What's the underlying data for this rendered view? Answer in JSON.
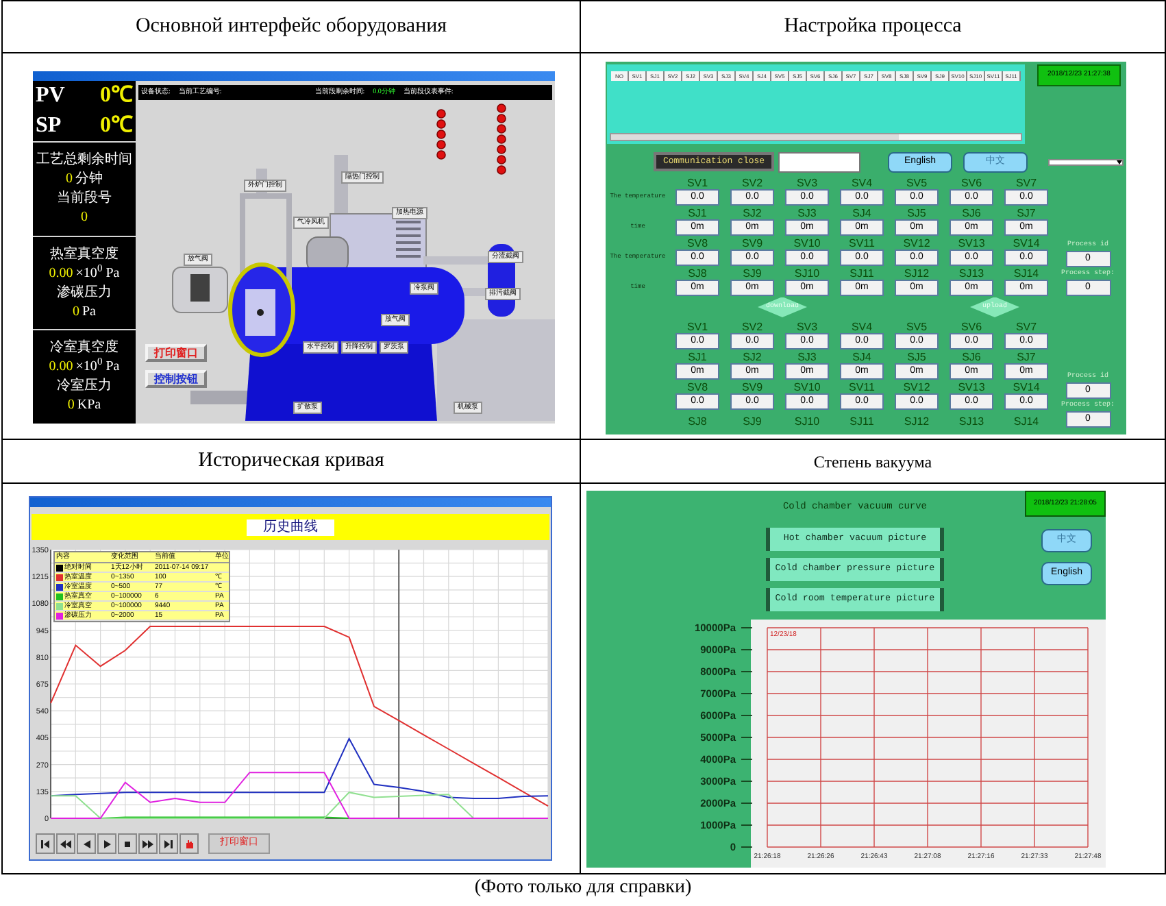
{
  "figures": [
    {
      "kind": "equipment",
      "heading": "Основной интерфейс оборудования",
      "screen": {
        "readout_boxes": [
          {
            "kind": "large",
            "lines": [
              [
                {
                  "kind": "label",
                  "text": "PV"
                },
                {
                  "kind": "value",
                  "text": "0℃"
                }
              ],
              [
                {
                  "kind": "label",
                  "text": "SP"
                },
                {
                  "kind": "value",
                  "text": "0℃"
                }
              ]
            ]
          },
          {
            "kind": "normal",
            "lines": [
              [
                {
                  "kind": "label",
                  "text": "工艺总剩余时间"
                }
              ],
              [
                {
                  "kind": "value",
                  "text": "0"
                },
                {
                  "kind": "label",
                  "text": "分钟"
                }
              ],
              [
                {
                  "kind": "label",
                  "text": "当前段号"
                }
              ],
              [
                {
                  "kind": "value",
                  "text": "0"
                }
              ]
            ]
          },
          {
            "kind": "normal",
            "lines": [
              [
                {
                  "kind": "label",
                  "text": "热室真空度"
                }
              ],
              [
                {
                  "kind": "value",
                  "text": "0.00"
                },
                {
                  "kind": "label",
                  "text": "×10$^{0}$ Pa"
                }
              ],
              [
                {
                  "kind": "label",
                  "text": "渗碳压力"
                }
              ],
              [
                {
                  "kind": "value",
                  "text": "0"
                },
                {
                  "kind": "label",
                  "text": "Pa"
                }
              ]
            ]
          },
          {
            "kind": "normal",
            "lines": [
              [
                {
                  "kind": "label",
                  "text": "冷室真空度"
                }
              ],
              [
                {
                  "kind": "value",
                  "text": "0.00"
                },
                {
                  "kind": "label",
                  "text": "×10$^{0}$ Pa"
                }
              ],
              [
                {
                  "kind": "label",
                  "text": "冷室压力"
                }
              ],
              [
                {
                  "kind": "value",
                  "text": "0"
                },
                {
                  "kind": "label",
                  "text": "KPa"
                }
              ]
            ]
          }
        ],
        "status_bar": [
          {
            "kind": "label",
            "text": "设备状态:"
          },
          {
            "kind": "label",
            "text": "当前工艺编号:"
          },
          {
            "kind": "label",
            "text": "当前段剩余时间:"
          },
          {
            "kind": "value",
            "text": "0.0分钟"
          },
          {
            "kind": "label",
            "text": "当前段仪表事件:"
          }
        ],
        "diagram_labels": [
          "外炉门控制",
          "隔热门控制",
          "气冷风机",
          "加热电源",
          "放气阀",
          "分流截阀",
          "冷泵阀",
          "排污截阀",
          "放气阀",
          "水平控制",
          "升降控制",
          "罗茨泵",
          "扩散泵",
          "机械泵"
        ],
        "diagram_buttons": [
          {
            "label": "打印窗口",
            "color": "#e02020"
          },
          {
            "label": "控制按钮",
            "color": "#2030d0"
          }
        ]
      }
    },
    {
      "kind": "process",
      "heading": "Настройка процесса",
      "screen": {
        "record_list": {
          "columns": [
            "NO",
            "SV1",
            "SJ1",
            "SV2",
            "SJ2",
            "SV3",
            "SJ3",
            "SV4",
            "SJ4",
            "SV5",
            "SJ5",
            "SV6",
            "SJ6",
            "SV7",
            "SJ7",
            "SV8",
            "SJ8",
            "SV9",
            "SJ9",
            "SV10",
            "SJ10",
            "SV11",
            "SJ11"
          ]
        },
        "clock": "2018/12/23 21:27:38",
        "connection_button": "Communication close",
        "language_buttons": [
          "English",
          "中文"
        ],
        "groups": [
          {
            "rows": [
              {
                "label": "The temperature",
                "cells": [
                  {
                    "name": "SV1",
                    "value": "0.0"
                  },
                  {
                    "name": "SV2",
                    "value": "0.0"
                  },
                  {
                    "name": "SV3",
                    "value": "0.0"
                  },
                  {
                    "name": "SV4",
                    "value": "0.0"
                  },
                  {
                    "name": "SV5",
                    "value": "0.0"
                  },
                  {
                    "name": "SV6",
                    "value": "0.0"
                  },
                  {
                    "name": "SV7",
                    "value": "0.0"
                  }
                ]
              },
              {
                "label": "time",
                "cells": [
                  {
                    "name": "SJ1",
                    "value": "0m"
                  },
                  {
                    "name": "SJ2",
                    "value": "0m"
                  },
                  {
                    "name": "SJ3",
                    "value": "0m"
                  },
                  {
                    "name": "SJ4",
                    "value": "0m"
                  },
                  {
                    "name": "SJ5",
                    "value": "0m"
                  },
                  {
                    "name": "SJ6",
                    "value": "0m"
                  },
                  {
                    "name": "SJ7",
                    "value": "0m"
                  }
                ]
              },
              {
                "label": "The temperature",
                "cells": [
                  {
                    "name": "SV8",
                    "value": "0.0"
                  },
                  {
                    "name": "SV9",
                    "value": "0.0"
                  },
                  {
                    "name": "SV10",
                    "value": "0.0"
                  },
                  {
                    "name": "SV11",
                    "value": "0.0"
                  },
                  {
                    "name": "SV12",
                    "value": "0.0"
                  },
                  {
                    "name": "SV13",
                    "value": "0.0"
                  },
                  {
                    "name": "SV14",
                    "value": "0.0"
                  }
                ]
              },
              {
                "label": "time",
                "cells": [
                  {
                    "name": "SJ8",
                    "value": "0m"
                  },
                  {
                    "name": "SJ9",
                    "value": "0m"
                  },
                  {
                    "name": "SJ10",
                    "value": "0m"
                  },
                  {
                    "name": "SJ11",
                    "value": "0m"
                  },
                  {
                    "name": "SJ12",
                    "value": "0m"
                  },
                  {
                    "name": "SJ13",
                    "value": "0m"
                  },
                  {
                    "name": "SJ14",
                    "value": "0m"
                  }
                ]
              }
            ],
            "side": [
              {
                "label": "Process id",
                "value": "0"
              },
              {
                "label": "Process step:",
                "value": "0"
              }
            ]
          },
          {
            "rows": [
              {
                "cells": [
                  {
                    "name": "SV1",
                    "value": "0.0"
                  },
                  {
                    "name": "SV2",
                    "value": "0.0"
                  },
                  {
                    "name": "SV3",
                    "value": "0.0"
                  },
                  {
                    "name": "SV4",
                    "value": "0.0"
                  },
                  {
                    "name": "SV5",
                    "value": "0.0"
                  },
                  {
                    "name": "SV6",
                    "value": "0.0"
                  },
                  {
                    "name": "SV7",
                    "value": "0.0"
                  }
                ]
              },
              {
                "cells": [
                  {
                    "name": "SJ1",
                    "value": "0m"
                  },
                  {
                    "name": "SJ2",
                    "value": "0m"
                  },
                  {
                    "name": "SJ3",
                    "value": "0m"
                  },
                  {
                    "name": "SJ4",
                    "value": "0m"
                  },
                  {
                    "name": "SJ5",
                    "value": "0m"
                  },
                  {
                    "name": "SJ6",
                    "value": "0m"
                  },
                  {
                    "name": "SJ7",
                    "value": "0m"
                  }
                ]
              },
              {
                "cells": [
                  {
                    "name": "SV8",
                    "value": "0.0"
                  },
                  {
                    "name": "SV9",
                    "value": "0.0"
                  },
                  {
                    "name": "SV10",
                    "value": "0.0"
                  },
                  {
                    "name": "SV11",
                    "value": "0.0"
                  },
                  {
                    "name": "SV12",
                    "value": "0.0"
                  },
                  {
                    "name": "SV13",
                    "value": "0.0"
                  },
                  {
                    "name": "SV14",
                    "value": "0.0"
                  }
                ]
              },
              {
                "cells": [
                  {
                    "name": "SJ8"
                  },
                  {
                    "name": "SJ9"
                  },
                  {
                    "name": "SJ10"
                  },
                  {
                    "name": "SJ11"
                  },
                  {
                    "name": "SJ12"
                  },
                  {
                    "name": "SJ13"
                  },
                  {
                    "name": "SJ14"
                  }
                ]
              }
            ],
            "side": [
              {
                "label": "Process id",
                "value": "0"
              },
              {
                "label": "Process step:",
                "value": "0"
              }
            ]
          }
        ],
        "transfer_buttons": [
          "download",
          "upload"
        ]
      }
    },
    {
      "kind": "history",
      "heading": "Историческая кривая",
      "screen": {
        "title": "历史曲线",
        "legend": {
          "header": [
            "内容",
            "变化范围",
            "当前值",
            "单位"
          ],
          "time_row": {
            "color": "#000000",
            "cells": [
              "绝对时间",
              "1天12小时",
              "2011-07-14 09:17"
            ]
          },
          "rows": [
            {
              "cells": [
                "0~1350",
                "100",
                "℃"
              ]
            },
            {
              "cells": [
                "0~500",
                "77",
                "℃"
              ]
            },
            {
              "cells": [
                "0~100000",
                "6",
                "PA"
              ]
            },
            {
              "cells": [
                "0~100000",
                "9440",
                "PA"
              ]
            },
            {
              "cells": [
                "0~2000",
                "15",
                "PA"
              ]
            }
          ]
        },
        "chart_data": {
          "type": "line",
          "grid": true,
          "legend": "upper left",
          "ylim": [
            0,
            1350
          ],
          "yticks": [
            0,
            135,
            270,
            405,
            540,
            675,
            810,
            945,
            1080,
            1215,
            1350
          ],
          "categories": [
            null,
            null,
            null,
            null,
            null,
            null,
            null,
            null,
            null,
            null,
            null,
            null,
            null,
            null,
            null,
            null,
            null,
            null,
            null,
            null,
            null
          ],
          "series": [
            {
              "name": "热室温度",
              "color": "#e03030",
              "values": [
                578,
                869,
                764,
                844,
                964,
                964,
                964,
                964,
                964,
                964,
                964,
                964,
                910,
                562,
                491,
                419,
                348,
                276,
                205,
                133,
                61
              ]
            },
            {
              "name": "冷室温度",
              "color": "#2030c0",
              "values": [
                113,
                120,
                125,
                130,
                130,
                130,
                130,
                130,
                130,
                130,
                130,
                130,
                400,
                170,
                155,
                135,
                105,
                100,
                100,
                110,
                113
              ]
            },
            {
              "name": "热室真空",
              "color": "#20c020",
              "values": [
                0,
                0,
                0,
                5,
                5,
                5,
                5,
                5,
                5,
                5,
                5,
                5,
                0,
                0,
                0,
                0,
                0,
                0,
                0,
                null,
                null
              ]
            },
            {
              "name": "冷室真空",
              "color": "#90e090",
              "values": [
                113,
                113,
                0,
                0,
                0,
                0,
                0,
                0,
                0,
                0,
                0,
                0,
                130,
                105,
                110,
                115,
                120,
                0,
                0,
                null,
                null
              ]
            },
            {
              "name": "渗碳压力",
              "color": "#e020e0",
              "values": [
                0,
                0,
                0,
                180,
                80,
                100,
                80,
                80,
                230,
                230,
                230,
                230,
                0,
                0,
                0,
                0,
                0,
                0,
                0,
                0,
                0
              ]
            }
          ]
        },
        "print_button": "打印窗口"
      }
    },
    {
      "kind": "vacuum",
      "heading": "Степень вакуума",
      "screen": {
        "title": "Cold chamber vacuum curve",
        "clock": "2018/12/23 21:28:05",
        "picture_buttons": [
          "Hot chamber vacuum picture",
          "Cold chamber pressure picture",
          "Cold room temperature picture"
        ],
        "language_buttons": [
          "中文",
          "English"
        ],
        "date_label": "12/23/18",
        "chart_data": {
          "type": "line",
          "grid": true,
          "ylim": [
            0,
            10000
          ],
          "yticks": [
            {
              "value": 0,
              "label": "0"
            },
            {
              "value": 1000,
              "label": "1000Pa"
            },
            {
              "value": 2000,
              "label": "2000Pa"
            },
            {
              "value": 3000,
              "label": "3000Pa"
            },
            {
              "value": 4000,
              "label": "4000Pa"
            },
            {
              "value": 5000,
              "label": "5000Pa"
            },
            {
              "value": 6000,
              "label": "6000Pa"
            },
            {
              "value": 7000,
              "label": "7000Pa"
            },
            {
              "value": 8000,
              "label": "8000Pa"
            },
            {
              "value": 9000,
              "label": "9000Pa"
            },
            {
              "value": 10000,
              "label": "10000Pa"
            }
          ],
          "categories": [
            "21:26:18",
            "21:26:26",
            "21:26:43",
            "21:27:08",
            "21:27:16",
            "21:27:33",
            "21:27:48"
          ]
        }
      }
    }
  ],
  "caption": "(Фото только для справки)"
}
